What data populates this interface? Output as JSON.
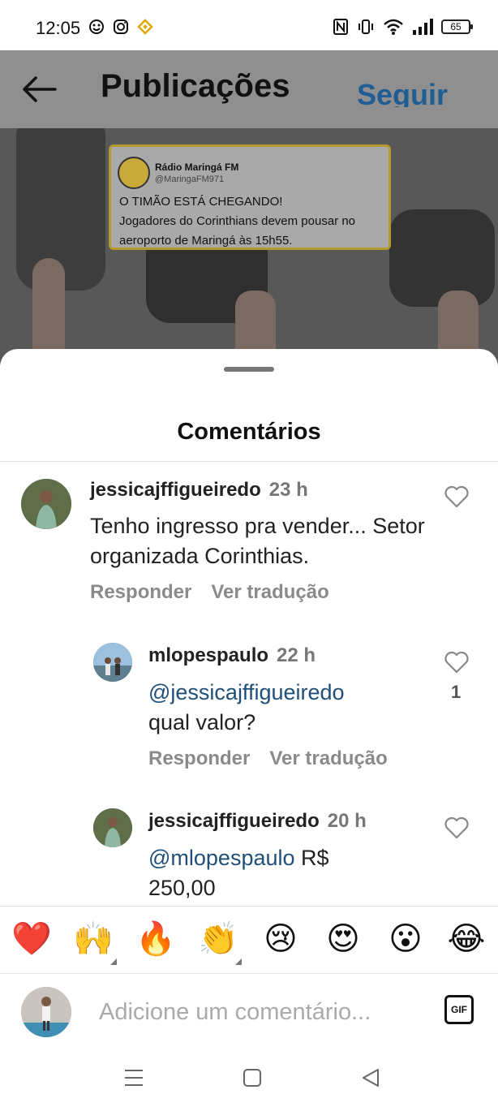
{
  "status_bar": {
    "time": "12:05",
    "battery": "65",
    "icons": [
      "face-icon",
      "instagram-icon",
      "binance-icon",
      "nfc-icon",
      "vibrate-icon",
      "wifi-icon",
      "signal-icon",
      "battery-icon"
    ]
  },
  "header": {
    "title": "Publicações",
    "follow_label": "Seguir"
  },
  "post_image": {
    "tweet_account": "Rádio Maringá FM",
    "tweet_handle": "@MaringaFM971",
    "tweet_line1": "O TIMÃO ESTÁ CHEGANDO!",
    "tweet_line2": "Jogadores do Corinthians devem pousar no aeroporto de Maringá às 15h55."
  },
  "comments_sheet": {
    "title": "Comentários",
    "reply_label": "Responder",
    "translate_label": "Ver tradução",
    "comments": [
      {
        "username": "jessicajffigueiredo",
        "time": "23 h",
        "text": "Tenho ingresso pra vender... Setor organizada Corinthias."
      },
      {
        "username": "mlopespaulo",
        "time": "22 h",
        "mention": "@jessicajffigueiredo",
        "text": "qual valor?",
        "likes": "1"
      },
      {
        "username": "jessicajffigueiredo",
        "time": "20 h",
        "mention": "@mlopespaulo",
        "text": "R$ 250,00"
      }
    ]
  },
  "emoji_bar": [
    "❤️",
    "🙌",
    "🔥",
    "👏",
    "😢",
    "😍",
    "😮",
    "😂"
  ],
  "input": {
    "placeholder": "Adicione um comentário...",
    "gif_label": "GIF"
  },
  "colors": {
    "link": "#1f4e79",
    "follow": "#1f5d93",
    "muted": "#8a8a8a"
  }
}
